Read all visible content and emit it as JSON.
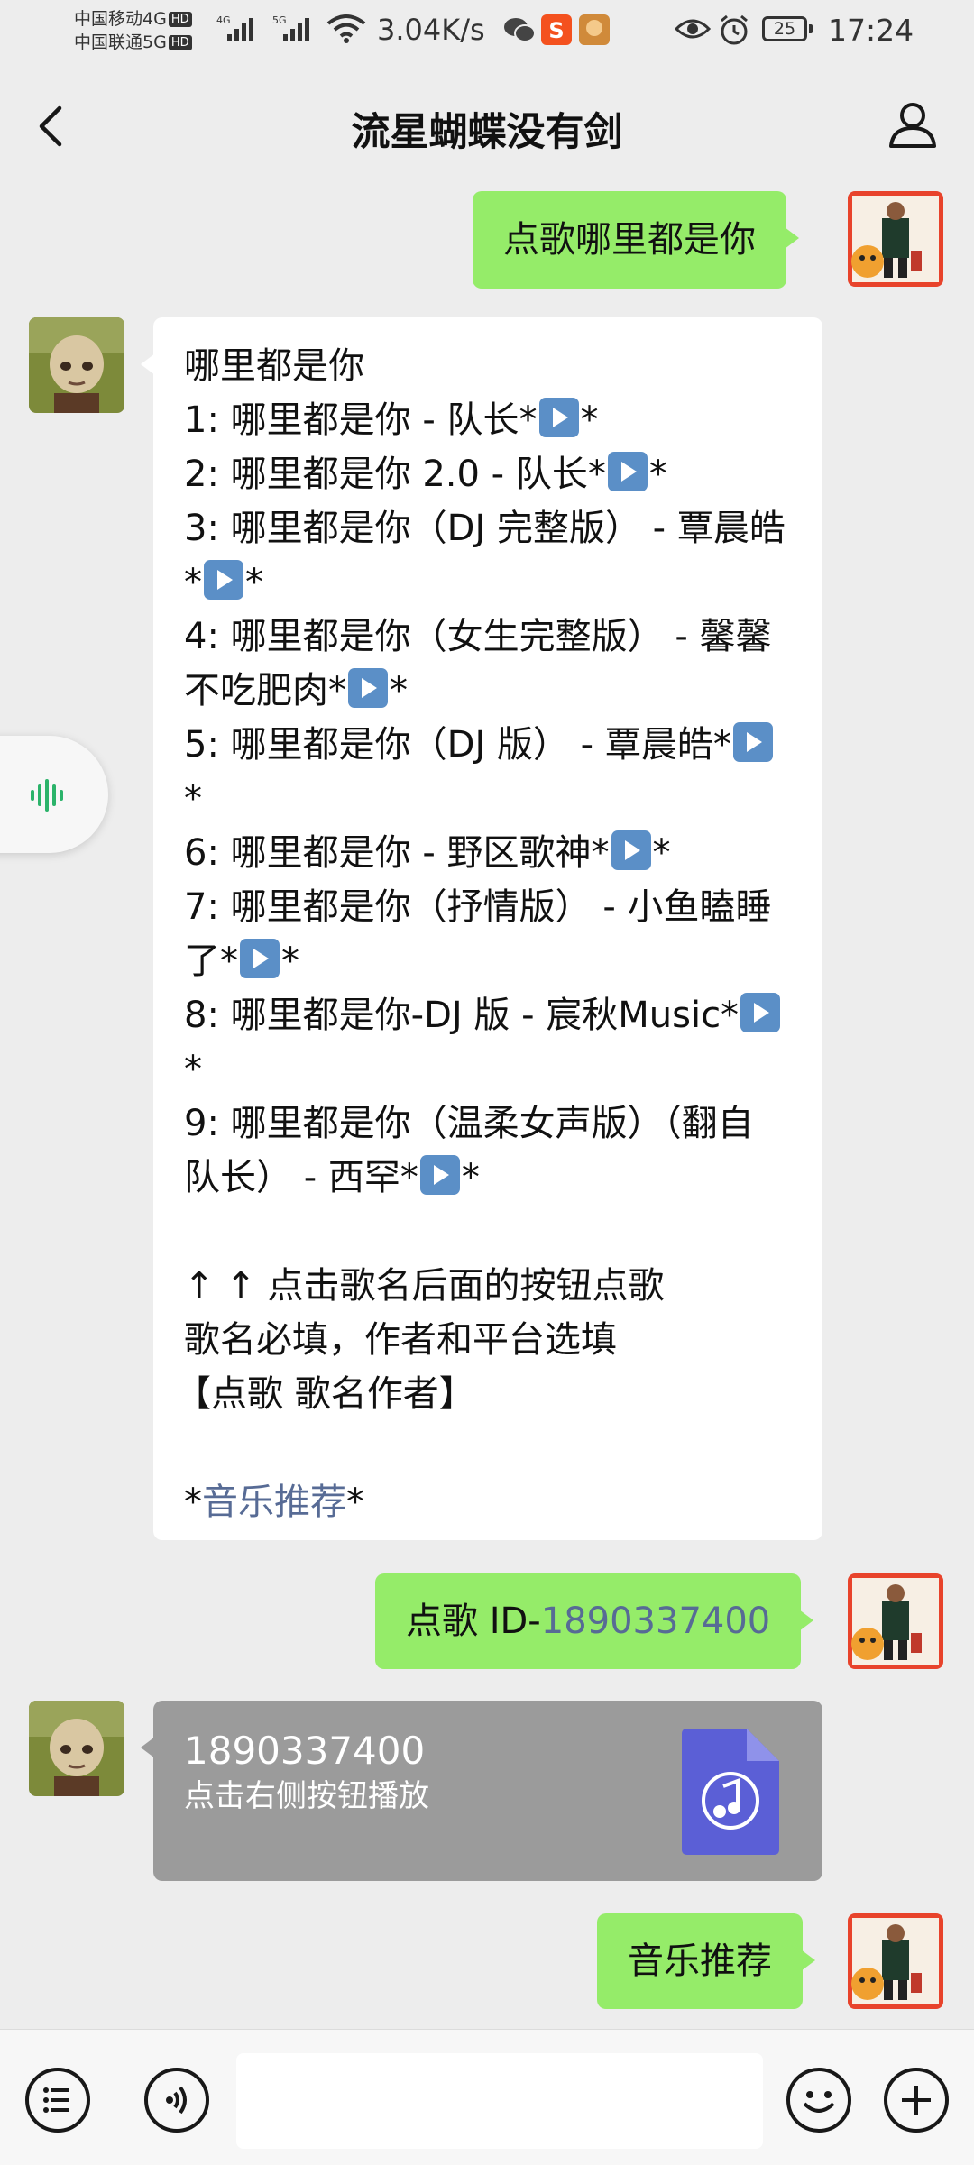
{
  "status_bar": {
    "carrier_1": "中国移动4G",
    "carrier_2": "中国联通5G",
    "hd": "HD",
    "net_speed": "3.04K/s",
    "battery": "25",
    "time": "17:24"
  },
  "nav": {
    "title": "流星蝴蝶没有剑"
  },
  "messages": {
    "m1": {
      "text": "点歌哪里都是你"
    },
    "m2": {
      "heading": "哪里都是你",
      "songs": [
        "1: 哪里都是你 - 队长*",
        "2: 哪里都是你 2.0 - 队长*",
        "3: 哪里都是你（DJ 完整版） - 覃晨皓*",
        "4: 哪里都是你（女生完整版） - 馨馨不吃肥肉*",
        "5: 哪里都是你（DJ 版） - 覃晨皓*",
        "6: 哪里都是你 - 野区歌神*",
        "7: 哪里都是你（抒情版） - 小鱼瞌睡了*",
        "8: 哪里都是你-DJ 版 - 宸秋Music*",
        "9: 哪里都是你（温柔女声版）（翻自 队长） - 西罕*"
      ],
      "star": "*",
      "hint_1": "↑ ↑ 点击歌名后面的按钮点歌",
      "hint_2": "歌名必填，作者和平台选填",
      "hint_3": "【点歌 歌名作者】",
      "recommend_prefix": "*",
      "recommend_link": "音乐推荐",
      "recommend_suffix": "*"
    },
    "m3": {
      "prefix": "点歌 ID-",
      "id": "1890337400"
    },
    "m4": {
      "title": "1890337400",
      "subtitle": "点击右侧按钮播放"
    },
    "m5": {
      "text": "音乐推荐"
    }
  },
  "colors": {
    "background": "#ededed",
    "bubble_green": "#95ec69",
    "link": "#576b95",
    "music_card": "#9b9b9b",
    "music_icon": "#5b5fd6"
  },
  "icons": [
    "back-arrow-icon",
    "contact-icon",
    "voice-wave-icon",
    "list-icon",
    "voice-input-icon",
    "emoji-icon",
    "add-icon",
    "music-file-icon",
    "play-button-icon"
  ]
}
